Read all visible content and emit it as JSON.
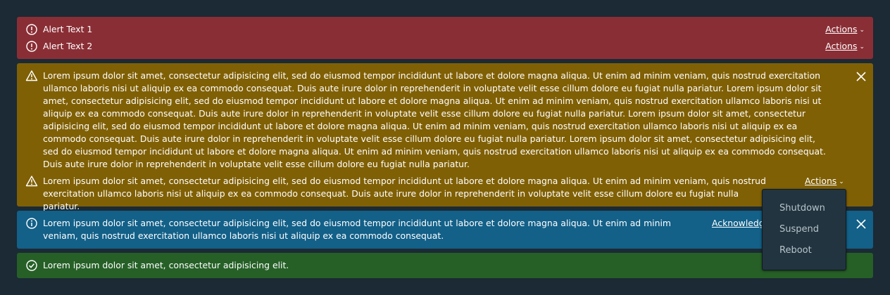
{
  "danger_alert": {
    "items": [
      {
        "text": "Alert Text 1",
        "action_label": "Actions",
        "icon": "exclamation-circle-icon"
      },
      {
        "text": "Alert Text 2",
        "action_label": "Actions",
        "icon": "exclamation-circle-icon"
      }
    ],
    "color": "#8a2e35"
  },
  "warning_alert": {
    "items": [
      {
        "text": "Lorem ipsum dolor sit amet, consectetur adipisicing elit, sed do eiusmod tempor incididunt ut labore et dolore magna aliqua. Ut enim ad minim veniam, quis nostrud exercitation ullamco laboris nisi ut aliquip ex ea commodo consequat. Duis aute irure dolor in reprehenderit in voluptate velit esse cillum dolore eu fugiat nulla pariatur. Lorem ipsum dolor sit amet, consectetur adipisicing elit, sed do eiusmod tempor incididunt ut labore et dolore magna aliqua. Ut enim ad minim veniam, quis nostrud exercitation ullamco laboris nisi ut aliquip ex ea commodo consequat. Duis aute irure dolor in reprehenderit in voluptate velit esse cillum dolore eu fugiat nulla pariatur. Lorem ipsum dolor sit amet, consectetur adipisicing elit, sed do eiusmod tempor incididunt ut labore et dolore magna aliqua. Ut enim ad minim veniam, quis nostrud exercitation ullamco laboris nisi ut aliquip ex ea commodo consequat. Duis aute irure dolor in reprehenderit in voluptate velit esse cillum dolore eu fugiat nulla pariatur. Lorem ipsum dolor sit amet, consectetur adipisicing elit, sed do eiusmod tempor incididunt ut labore et dolore magna aliqua. Ut enim ad minim veniam, quis nostrud exercitation ullamco laboris nisi ut aliquip ex ea commodo consequat. Duis aute irure dolor in reprehenderit in voluptate velit esse cillum dolore eu fugiat nulla pariatur.",
        "icon": "warning-triangle-icon"
      },
      {
        "text": "Lorem ipsum dolor sit amet, consectetur adipisicing elit, sed do eiusmod tempor incididunt ut labore et dolore magna aliqua. Ut enim ad minim veniam, quis nostrud exercitation ullamco laboris nisi ut aliquip ex ea commodo consequat. Duis aute irure dolor in reprehenderit in voluptate velit esse cillum dolore eu fugiat nulla pariatur.",
        "action_label": "Actions",
        "icon": "warning-triangle-icon"
      }
    ],
    "close_icon": "close-icon",
    "color": "#806005"
  },
  "info_alert": {
    "text": "Lorem ipsum dolor sit amet, consectetur adipisicing elit, sed do eiusmod tempor incididunt ut labore et dolore magna aliqua. Ut enim ad minim veniam, quis nostrud exercitation ullamco laboris nisi ut aliquip ex ea commodo consequat.",
    "action_label": "Acknowledge",
    "icon": "info-circle-icon",
    "close_icon": "close-icon",
    "color": "#136088"
  },
  "success_alert": {
    "text": "Lorem ipsum dolor sit amet, consectetur adipisicing elit.",
    "icon": "check-circle-icon",
    "color": "#266027"
  },
  "actions_dropdown": {
    "items": [
      "Shutdown",
      "Suspend",
      "Reboot"
    ]
  }
}
